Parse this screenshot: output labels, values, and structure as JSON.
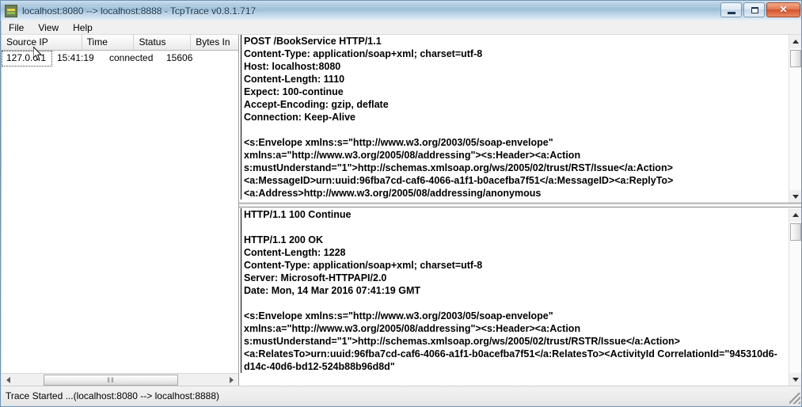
{
  "window": {
    "title": "localhost:8080 --> localhost:8888 - TcpTrace v0.8.1.717",
    "icon": "tcptrace-app-icon",
    "controls": {
      "minimize": "–",
      "maximize": "□",
      "close": "✕"
    }
  },
  "menubar": {
    "items": [
      {
        "label": "File"
      },
      {
        "label": "View"
      },
      {
        "label": "Help"
      }
    ]
  },
  "connection_list": {
    "columns": [
      "Source IP",
      "Time",
      "Status",
      "Bytes In"
    ],
    "rows": [
      {
        "source_ip": "127.0.0.1",
        "time": "15:41:19",
        "status": "connected",
        "bytes_in": "15606"
      }
    ]
  },
  "request_pane": {
    "name": "request-text",
    "content": "POST /BookService HTTP/1.1\nContent-Type: application/soap+xml; charset=utf-8\nHost: localhost:8080\nContent-Length: 1110\nExpect: 100-continue\nAccept-Encoding: gzip, deflate\nConnection: Keep-Alive\n\n<s:Envelope xmlns:s=\"http://www.w3.org/2003/05/soap-envelope\" xmlns:a=\"http://www.w3.org/2005/08/addressing\"><s:Header><a:Action s:mustUnderstand=\"1\">http://schemas.xmlsoap.org/ws/2005/02/trust/RST/Issue</a:Action><a:MessageID>urn:uuid:96fba7cd-caf6-4066-a1f1-b0acefba7f51</a:MessageID><a:ReplyTo><a:Address>http://www.w3.org/2005/08/addressing/anonymous"
  },
  "response_pane": {
    "name": "response-text",
    "content": "HTTP/1.1 100 Continue\n\nHTTP/1.1 200 OK\nContent-Length: 1228\nContent-Type: application/soap+xml; charset=utf-8\nServer: Microsoft-HTTPAPI/2.0\nDate: Mon, 14 Mar 2016 07:41:19 GMT\n\n<s:Envelope xmlns:s=\"http://www.w3.org/2003/05/soap-envelope\" xmlns:a=\"http://www.w3.org/2005/08/addressing\"><s:Header><a:Action s:mustUnderstand=\"1\">http://schemas.xmlsoap.org/ws/2005/02/trust/RSTR/Issue</a:Action><a:RelatesTo>urn:uuid:96fba7cd-caf6-4066-a1f1-b0acefba7f51</a:RelatesTo><ActivityId CorrelationId=\"945310d6-d14c-40d6-bd12-524b88b96d8d\""
  },
  "scrollbars": {
    "list_horizontal": {
      "grip": "‖‖"
    },
    "up_arrow": "▲",
    "down_arrow": "▼",
    "left_arrow": "◄",
    "right_arrow": "►"
  },
  "statusbar": {
    "text": "Trace Started ...(localhost:8080 --> localhost:8888)"
  },
  "colors": {
    "titlebar_text": "#17334d",
    "close_button": "#d4522a",
    "pane_background": "#ffffff",
    "list_border": "#a0a0a0"
  }
}
